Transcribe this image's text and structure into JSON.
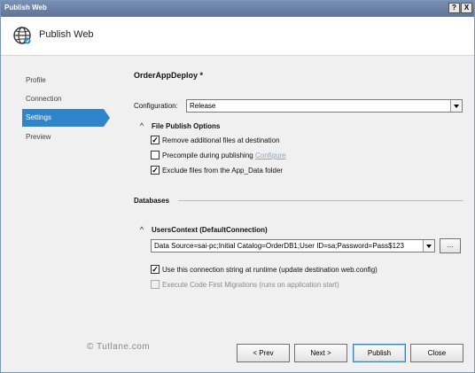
{
  "window": {
    "title": "Publish Web",
    "help_button": "?",
    "close_button": "X"
  },
  "header": {
    "title": "Publish Web",
    "icon": "globe-icon"
  },
  "sidebar": {
    "items": [
      {
        "label": "Profile",
        "active": false
      },
      {
        "label": "Connection",
        "active": false
      },
      {
        "label": "Settings",
        "active": true
      },
      {
        "label": "Preview",
        "active": false
      }
    ]
  },
  "main": {
    "profile_title": "OrderAppDeploy *",
    "configuration_label": "Configuration:",
    "configuration_value": "Release",
    "file_publish": {
      "heading": "File Publish Options",
      "options": [
        {
          "label": "Remove additional files at destination",
          "checked": true
        },
        {
          "label": "Precompile during publishing",
          "checked": false,
          "link": "Configure"
        },
        {
          "label": "Exclude files from the App_Data folder",
          "checked": true
        }
      ]
    },
    "databases": {
      "heading": "Databases",
      "context_heading": "UsersContext (DefaultConnection)",
      "connection_string": "Data Source=sai-pc;Initial Catalog=OrderDB1;User ID=sa;Password=Pass$123",
      "browse_label": "...",
      "use_connection": {
        "label": "Use this connection string at runtime (update destination web.config)",
        "checked": true
      },
      "code_first": {
        "label": "Execute Code First Migrations (runs on application start)",
        "checked": false,
        "disabled": true
      }
    }
  },
  "footer": {
    "watermark": "© Tutlane.com",
    "buttons": {
      "prev": "< Prev",
      "next": "Next >",
      "publish": "Publish",
      "close": "Close"
    }
  },
  "colors": {
    "accent": "#2f85cc",
    "titlebar": "#6a80a8",
    "link": "#8aa6c8"
  }
}
